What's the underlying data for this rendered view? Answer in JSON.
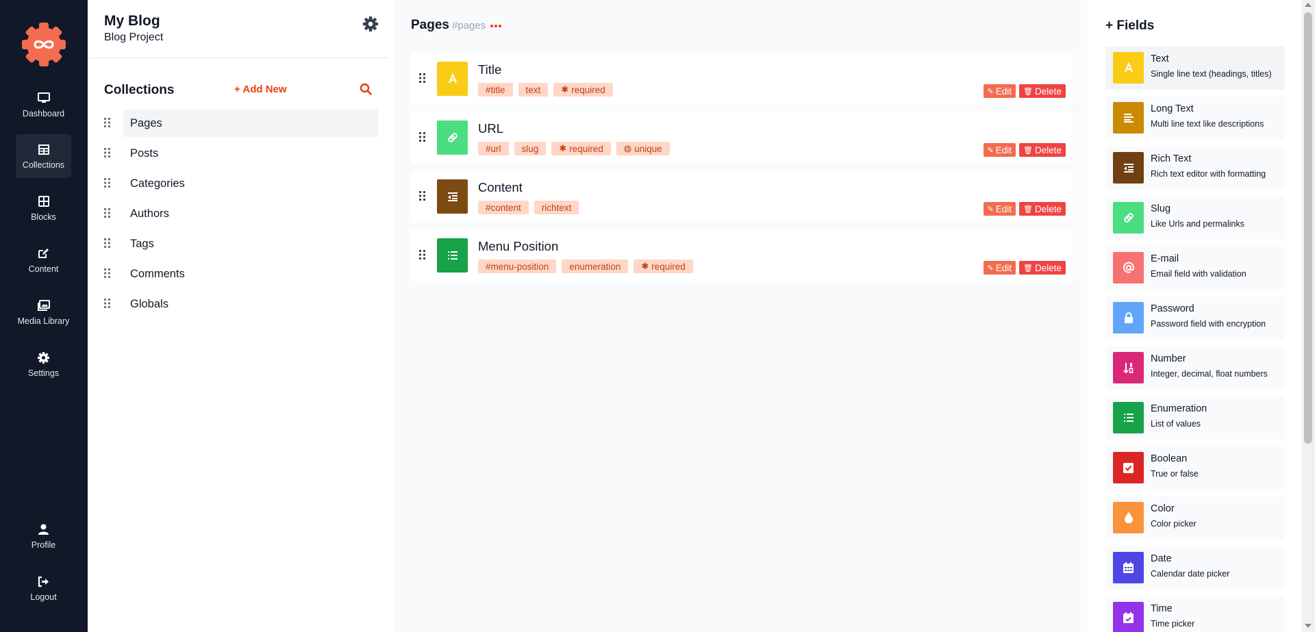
{
  "nav": {
    "logo_icon": "gear-infinity-logo",
    "items": [
      {
        "label": "Dashboard",
        "icon": "monitor-icon"
      },
      {
        "label": "Collections",
        "icon": "table-icon",
        "active": true
      },
      {
        "label": "Blocks",
        "icon": "grid-icon"
      },
      {
        "label": "Content",
        "icon": "edit-icon"
      },
      {
        "label": "Media Library",
        "icon": "images-icon"
      },
      {
        "label": "Settings",
        "icon": "gear-icon"
      }
    ],
    "bottom": [
      {
        "label": "Profile",
        "icon": "user-icon"
      },
      {
        "label": "Logout",
        "icon": "logout-icon"
      }
    ]
  },
  "project": {
    "title": "My Blog",
    "subtitle": "Blog Project"
  },
  "collections": {
    "heading": "Collections",
    "add_new": "+ Add New",
    "items": [
      "Pages",
      "Posts",
      "Categories",
      "Authors",
      "Tags",
      "Comments",
      "Globals"
    ],
    "active": "Pages"
  },
  "main": {
    "title": "Pages",
    "slug": "#pages",
    "edit_label": "Edit",
    "delete_label": "Delete",
    "fields": [
      {
        "name": "Title",
        "icon": "text-a-icon",
        "color": "#facc15",
        "tags": [
          {
            "text": "#title"
          },
          {
            "text": "text"
          },
          {
            "text": "required",
            "icon": "asterisk-icon"
          }
        ]
      },
      {
        "name": "URL",
        "icon": "link-icon",
        "color": "#4ade80",
        "tags": [
          {
            "text": "#url"
          },
          {
            "text": "slug"
          },
          {
            "text": "required",
            "icon": "asterisk-icon"
          },
          {
            "text": "unique",
            "icon": "fingerprint-icon"
          }
        ]
      },
      {
        "name": "Content",
        "icon": "richtext-icon",
        "color": "#7c4a12",
        "tags": [
          {
            "text": "#content"
          },
          {
            "text": "richtext"
          }
        ]
      },
      {
        "name": "Menu Position",
        "icon": "list-icon",
        "color": "#16a34a",
        "tags": [
          {
            "text": "#menu-position"
          },
          {
            "text": "enumeration"
          },
          {
            "text": "required",
            "icon": "asterisk-icon"
          }
        ]
      }
    ]
  },
  "fields_panel": {
    "title": "+ Fields",
    "types": [
      {
        "name": "Text",
        "desc": "Single line text (headings, titles)",
        "icon": "text-a-icon",
        "color": "#facc15"
      },
      {
        "name": "Long Text",
        "desc": "Multi line text like descriptions",
        "icon": "align-left-icon",
        "color": "#ca8a04"
      },
      {
        "name": "Rich Text",
        "desc": "Rich text editor with formatting",
        "icon": "richtext-icon",
        "color": "#713f12"
      },
      {
        "name": "Slug",
        "desc": "Like Urls and permalinks",
        "icon": "link-icon",
        "color": "#4ade80"
      },
      {
        "name": "E-mail",
        "desc": "Email field with validation",
        "icon": "at-icon",
        "color": "#f87171"
      },
      {
        "name": "Password",
        "desc": "Password field with encryption",
        "icon": "lock-icon",
        "color": "#60a5fa"
      },
      {
        "name": "Number",
        "desc": "Integer, decimal, float numbers",
        "icon": "sort-numeric-icon",
        "color": "#db2777"
      },
      {
        "name": "Enumeration",
        "desc": "List of values",
        "icon": "list-icon",
        "color": "#16a34a"
      },
      {
        "name": "Boolean",
        "desc": "True or false",
        "icon": "checkbox-icon",
        "color": "#dc2626"
      },
      {
        "name": "Color",
        "desc": "Color picker",
        "icon": "droplet-icon",
        "color": "#fb923c"
      },
      {
        "name": "Date",
        "desc": "Calendar date picker",
        "icon": "calendar-icon",
        "color": "#4f46e5"
      },
      {
        "name": "Time",
        "desc": "Time picker",
        "icon": "calendar-check-icon",
        "color": "#9333ea"
      }
    ]
  },
  "colors": {
    "accent": "#ea3d0c",
    "nav_bg": "#111827",
    "tag_bg": "#fed7c8",
    "edit_btn": "#f26c4f",
    "delete_btn": "#ef4444"
  }
}
